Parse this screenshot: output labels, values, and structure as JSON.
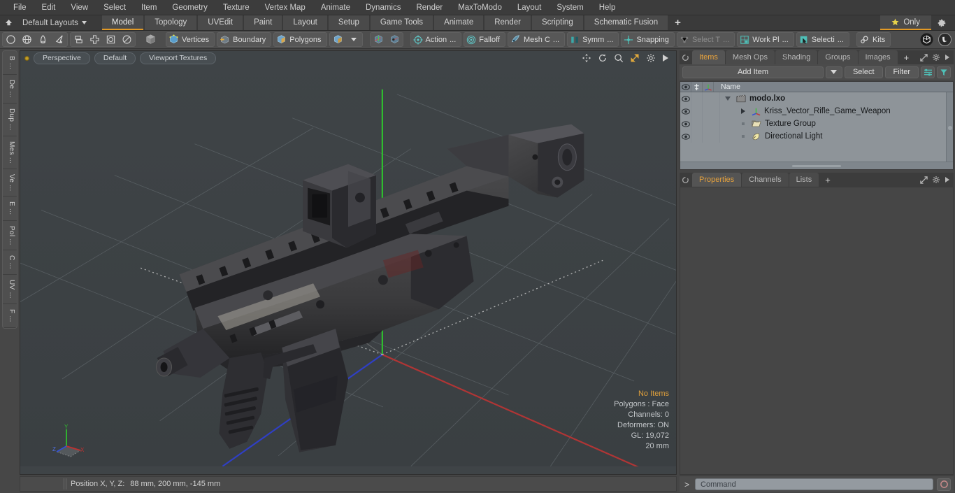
{
  "menu": {
    "items": [
      "File",
      "Edit",
      "View",
      "Select",
      "Item",
      "Geometry",
      "Texture",
      "Vertex Map",
      "Animate",
      "Dynamics",
      "Render",
      "MaxToModo",
      "Layout",
      "System",
      "Help"
    ]
  },
  "layoutbar": {
    "layouts_label": "Default Layouts",
    "tabs": [
      {
        "label": "Model",
        "active": true
      },
      {
        "label": "Topology",
        "active": false
      },
      {
        "label": "UVEdit",
        "active": false
      },
      {
        "label": "Paint",
        "active": false
      },
      {
        "label": "Layout",
        "active": false
      },
      {
        "label": "Setup",
        "active": false
      },
      {
        "label": "Game Tools",
        "active": false
      },
      {
        "label": "Animate",
        "active": false
      },
      {
        "label": "Render",
        "active": false
      },
      {
        "label": "Scripting",
        "active": false
      },
      {
        "label": "Schematic Fusion",
        "active": false
      }
    ],
    "add_tab_label": "+",
    "only_label": "Only"
  },
  "toolbar": {
    "primitives": [
      "cube-icon",
      "sphere-icon",
      "cylinder-icon",
      "cone-icon"
    ],
    "group_b": [
      "stack-icon",
      "plus-shape-icon",
      "square-inner-icon",
      "circle-inner-icon"
    ],
    "single_cube": "cube-grey-icon",
    "selection_modes": [
      {
        "label": "Vertices",
        "icon": "vertices-cube-icon"
      },
      {
        "label": "Boundary",
        "icon": "boundary-cube-icon"
      },
      {
        "label": "Polygons",
        "icon": "polygons-cube-icon"
      }
    ],
    "mode_dropdown_icon": "chevron-down-icon",
    "xform_a": "transform-icon-a",
    "xform_b": "transform-icon-b",
    "tools": [
      {
        "label": "Action",
        "suffix": "...",
        "icon": "action-center-icon",
        "dim": false
      },
      {
        "label": "Falloff",
        "suffix": "",
        "icon": "falloff-icon",
        "dim": false
      },
      {
        "label": "Mesh C",
        "suffix": "...",
        "icon": "mesh-constraint-icon",
        "dim": false
      },
      {
        "label": "Symm",
        "suffix": "...",
        "icon": "symmetry-icon",
        "dim": false
      },
      {
        "label": "Snapping",
        "suffix": "",
        "icon": "snapping-icon",
        "dim": false
      },
      {
        "label": "Select T",
        "suffix": "...",
        "icon": "select-through-icon",
        "dim": true
      },
      {
        "label": "Work Pl",
        "suffix": "...",
        "icon": "work-plane-icon",
        "dim": false
      },
      {
        "label": "Selecti",
        "suffix": "...",
        "icon": "selection-set-icon",
        "dim": false
      },
      {
        "label": "Kits",
        "suffix": "",
        "icon": "kits-gears-icon",
        "dim": false
      }
    ],
    "right_icons": [
      "modo-badge-icon",
      "unreal-badge-icon"
    ]
  },
  "left_strip": {
    "tabs": [
      "B ...",
      "De ...",
      "Dup ...",
      "Mes ...",
      "Ve ...",
      "E ...",
      "Pol ...",
      "C ...",
      "UV ...",
      "F ..."
    ]
  },
  "viewport": {
    "view_label": "Perspective",
    "shading_label": "Default",
    "texture_label": "Viewport Textures",
    "nav_icons": [
      "pan-icon",
      "rotate-icon",
      "zoom-icon",
      "maximize-icon",
      "gear-icon",
      "play-icon"
    ],
    "stats": {
      "selection": "No Items",
      "polygons": "Polygons : Face",
      "channels": "Channels: 0",
      "deformers": "Deformers: ON",
      "gl": "GL: 19,072",
      "grid": "20 mm"
    },
    "axis_labels": {
      "x": "X",
      "y": "Y",
      "z": "Z"
    },
    "colors": {
      "background": "#3f4447",
      "axis_y": "#2fbd2f",
      "axis_x": "#c03030",
      "axis_z": "#3040c8",
      "grid": "#5a6165"
    }
  },
  "status_bar": {
    "position_label": "Position X, Y, Z:",
    "position_value": "88 mm, 200 mm, -145 mm"
  },
  "right_panel": {
    "tabs": [
      {
        "label": "Items",
        "active": true
      },
      {
        "label": "Mesh Ops",
        "active": false
      },
      {
        "label": "Shading",
        "active": false
      },
      {
        "label": "Groups",
        "active": false
      },
      {
        "label": "Images",
        "active": false
      }
    ],
    "add_tab_label": "+",
    "header_icons": [
      "expand-icon",
      "gear-icon",
      "play-icon"
    ],
    "toolrow": {
      "add_item_label": "Add Item",
      "dropdown_icon": "chevron-down-icon",
      "select_label": "Select",
      "filter_label": "Filter",
      "list-options-icon": "list-options-icon",
      "funnel-icon": "funnel-icon"
    },
    "tree": {
      "columns": [
        "eye-icon",
        "lock-icon",
        "axis-icon",
        "Name"
      ],
      "name_header": "Name",
      "rows": [
        {
          "name": "modo.lxo",
          "icon": "scene-clapper-icon",
          "depth": 0,
          "twisty": "open",
          "bold": true
        },
        {
          "name": "Kriss_Vector_Rifle_Game_Weapon",
          "icon": "mesh-axis-icon",
          "depth": 1,
          "twisty": "closed",
          "bold": false
        },
        {
          "name": "Texture Group",
          "icon": "folder-icon",
          "depth": 1,
          "twisty": "none",
          "bold": false
        },
        {
          "name": "Directional Light",
          "icon": "light-icon",
          "depth": 1,
          "twisty": "none",
          "bold": false
        }
      ]
    },
    "properties": {
      "tabs": [
        {
          "label": "Properties",
          "active": true
        },
        {
          "label": "Channels",
          "active": false
        },
        {
          "label": "Lists",
          "active": false
        }
      ],
      "add_tab_label": "+",
      "header_icons": [
        "expand-icon",
        "gear-icon",
        "play-icon"
      ]
    }
  },
  "command_bar": {
    "caret": ">",
    "placeholder": "Command",
    "record_icon": "record-circle-icon"
  },
  "theme": {
    "accent": "#e39a25",
    "panel_bg": "#454545",
    "toolbar_bg": "#4d4d4d",
    "tree_bg": "#8e9499"
  }
}
